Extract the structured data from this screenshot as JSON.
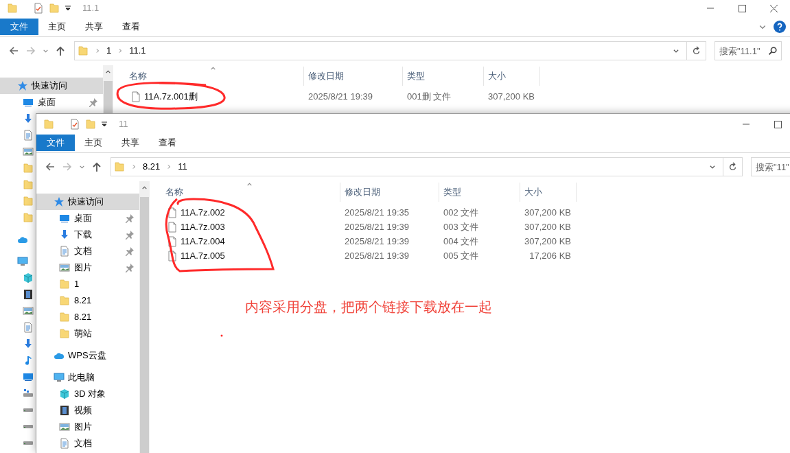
{
  "windows": [
    {
      "title": "11.1",
      "ribbon_tabs": [
        {
          "label": "文件",
          "selected": true
        },
        {
          "label": "主页",
          "selected": false
        },
        {
          "label": "共享",
          "selected": false
        },
        {
          "label": "查看",
          "selected": false
        }
      ],
      "path": [
        "1",
        "11.1"
      ],
      "search": {
        "placeholder": "搜索\"11.1\""
      },
      "sidebar": [
        {
          "label": "快速访问",
          "kind": "star",
          "selected": true,
          "children": [
            {
              "label": "桌面",
              "kind": "desktop",
              "pinned": true
            },
            {
              "kind": "download"
            },
            {
              "kind": "document"
            },
            {
              "kind": "picture"
            },
            {
              "kind": "folder"
            },
            {
              "kind": "folder"
            },
            {
              "kind": "folder"
            },
            {
              "kind": "folder"
            }
          ]
        },
        {
          "kind": "cloud",
          "selected": false
        },
        {
          "kind": "pc",
          "selected": false,
          "children": [
            {
              "kind": "cube"
            },
            {
              "kind": "video"
            },
            {
              "kind": "picture"
            },
            {
              "kind": "document"
            },
            {
              "kind": "download"
            },
            {
              "kind": "music"
            },
            {
              "kind": "desktop"
            },
            {
              "kind": "drive-net"
            },
            {
              "kind": "drive"
            },
            {
              "kind": "drive"
            },
            {
              "kind": "drive"
            }
          ]
        }
      ],
      "columns": [
        "名称",
        "修改日期",
        "类型",
        "大小"
      ],
      "files": [
        {
          "name": "11A.7z.001删",
          "date": "2025/8/21 19:39",
          "type": "001删 文件",
          "size": "307,200 KB"
        }
      ]
    },
    {
      "title": "11",
      "ribbon_tabs": [
        {
          "label": "文件",
          "selected": true
        },
        {
          "label": "主页",
          "selected": false
        },
        {
          "label": "共享",
          "selected": false
        },
        {
          "label": "查看",
          "selected": false
        }
      ],
      "path": [
        "8.21",
        "11"
      ],
      "search": {
        "placeholder": "搜索\"11\""
      },
      "sidebar": [
        {
          "label": "快速访问",
          "kind": "star",
          "selected": true,
          "children": [
            {
              "label": "桌面",
              "kind": "desktop",
              "pinned": true
            },
            {
              "label": "下载",
              "kind": "download",
              "pinned": true
            },
            {
              "label": "文档",
              "kind": "document",
              "pinned": true
            },
            {
              "label": "图片",
              "kind": "picture",
              "pinned": true
            },
            {
              "label": "1",
              "kind": "folder",
              "pinned": false
            },
            {
              "label": "8.21",
              "kind": "folder",
              "pinned": false
            },
            {
              "label": "8.21",
              "kind": "folder",
              "pinned": false
            },
            {
              "label": "萌站",
              "kind": "folder",
              "pinned": false
            }
          ]
        },
        {
          "label": "WPS云盘",
          "kind": "cloud",
          "selected": false
        },
        {
          "label": "此电脑",
          "kind": "pc",
          "selected": false,
          "children": [
            {
              "label": "3D 对象",
              "kind": "cube",
              "pinned": false
            },
            {
              "label": "视频",
              "kind": "video",
              "pinned": false
            },
            {
              "label": "图片",
              "kind": "picture",
              "pinned": false
            },
            {
              "label": "文档",
              "kind": "document",
              "pinned": false
            }
          ]
        }
      ],
      "columns": [
        "名称",
        "修改日期",
        "类型",
        "大小"
      ],
      "files": [
        {
          "name": "11A.7z.002",
          "date": "2025/8/21 19:35",
          "type": "002 文件",
          "size": "307,200 KB"
        },
        {
          "name": "11A.7z.003",
          "date": "2025/8/21 19:39",
          "type": "003 文件",
          "size": "307,200 KB"
        },
        {
          "name": "11A.7z.004",
          "date": "2025/8/21 19:39",
          "type": "004 文件",
          "size": "307,200 KB"
        },
        {
          "name": "11A.7z.005",
          "date": "2025/8/21 19:39",
          "type": "005 文件",
          "size": "17,206 KB"
        }
      ]
    }
  ],
  "annotation": {
    "text": "内容采用分盘，把两个链接下载放在一起"
  }
}
